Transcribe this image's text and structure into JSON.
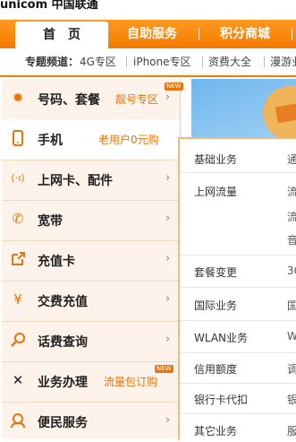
{
  "header": {
    "logo_text": "unicom 中国联通"
  },
  "nav": {
    "tabs": [
      {
        "label": "首　页",
        "active": true
      },
      {
        "label": "自助服务"
      },
      {
        "label": "积分商城"
      }
    ]
  },
  "special_channel": {
    "label": "专题频道：",
    "links": [
      "4G专区",
      "iPhone专区",
      "资费大全",
      "漫游业"
    ]
  },
  "menu": {
    "items": [
      {
        "icon": "gear-icon",
        "label": "号码、套餐",
        "promo": "靓号专区",
        "badge": "NEW"
      },
      {
        "icon": "phone-icon",
        "label": "手机",
        "promo": "老用户0元购"
      },
      {
        "icon": "antenna-icon",
        "label": "上网卡、配件"
      },
      {
        "icon": "telephone-icon",
        "label": "宽带"
      },
      {
        "icon": "external-link-icon",
        "label": "充值卡"
      },
      {
        "icon": "yen-icon",
        "label": "交费充值"
      },
      {
        "icon": "magnifier-icon",
        "label": "话费查询"
      },
      {
        "icon": "tools-icon",
        "label": "业务办理",
        "promo": "流量包订购",
        "badge": "NEW"
      },
      {
        "icon": "people-icon",
        "label": "便民服务"
      }
    ]
  },
  "panel": {
    "rows": [
      {
        "label": "基础业务",
        "values": [
          "通"
        ]
      },
      {
        "label": "上网流量",
        "values": [
          "流",
          "流",
          "音"
        ]
      },
      {
        "label": "套餐变更",
        "values": [
          "3G"
        ]
      },
      {
        "label": "国际业务",
        "values": [
          "国"
        ]
      },
      {
        "label": "WLAN业务",
        "values": [
          "W"
        ]
      },
      {
        "label": "信用额度",
        "values": [
          "调"
        ]
      },
      {
        "label": "银行卡代扣",
        "values": [
          "银"
        ]
      },
      {
        "label": "其它业务",
        "values": [
          "服"
        ]
      }
    ]
  },
  "colors": {
    "accent": "#f47a00",
    "menu_bg": "#fdf3ea"
  }
}
